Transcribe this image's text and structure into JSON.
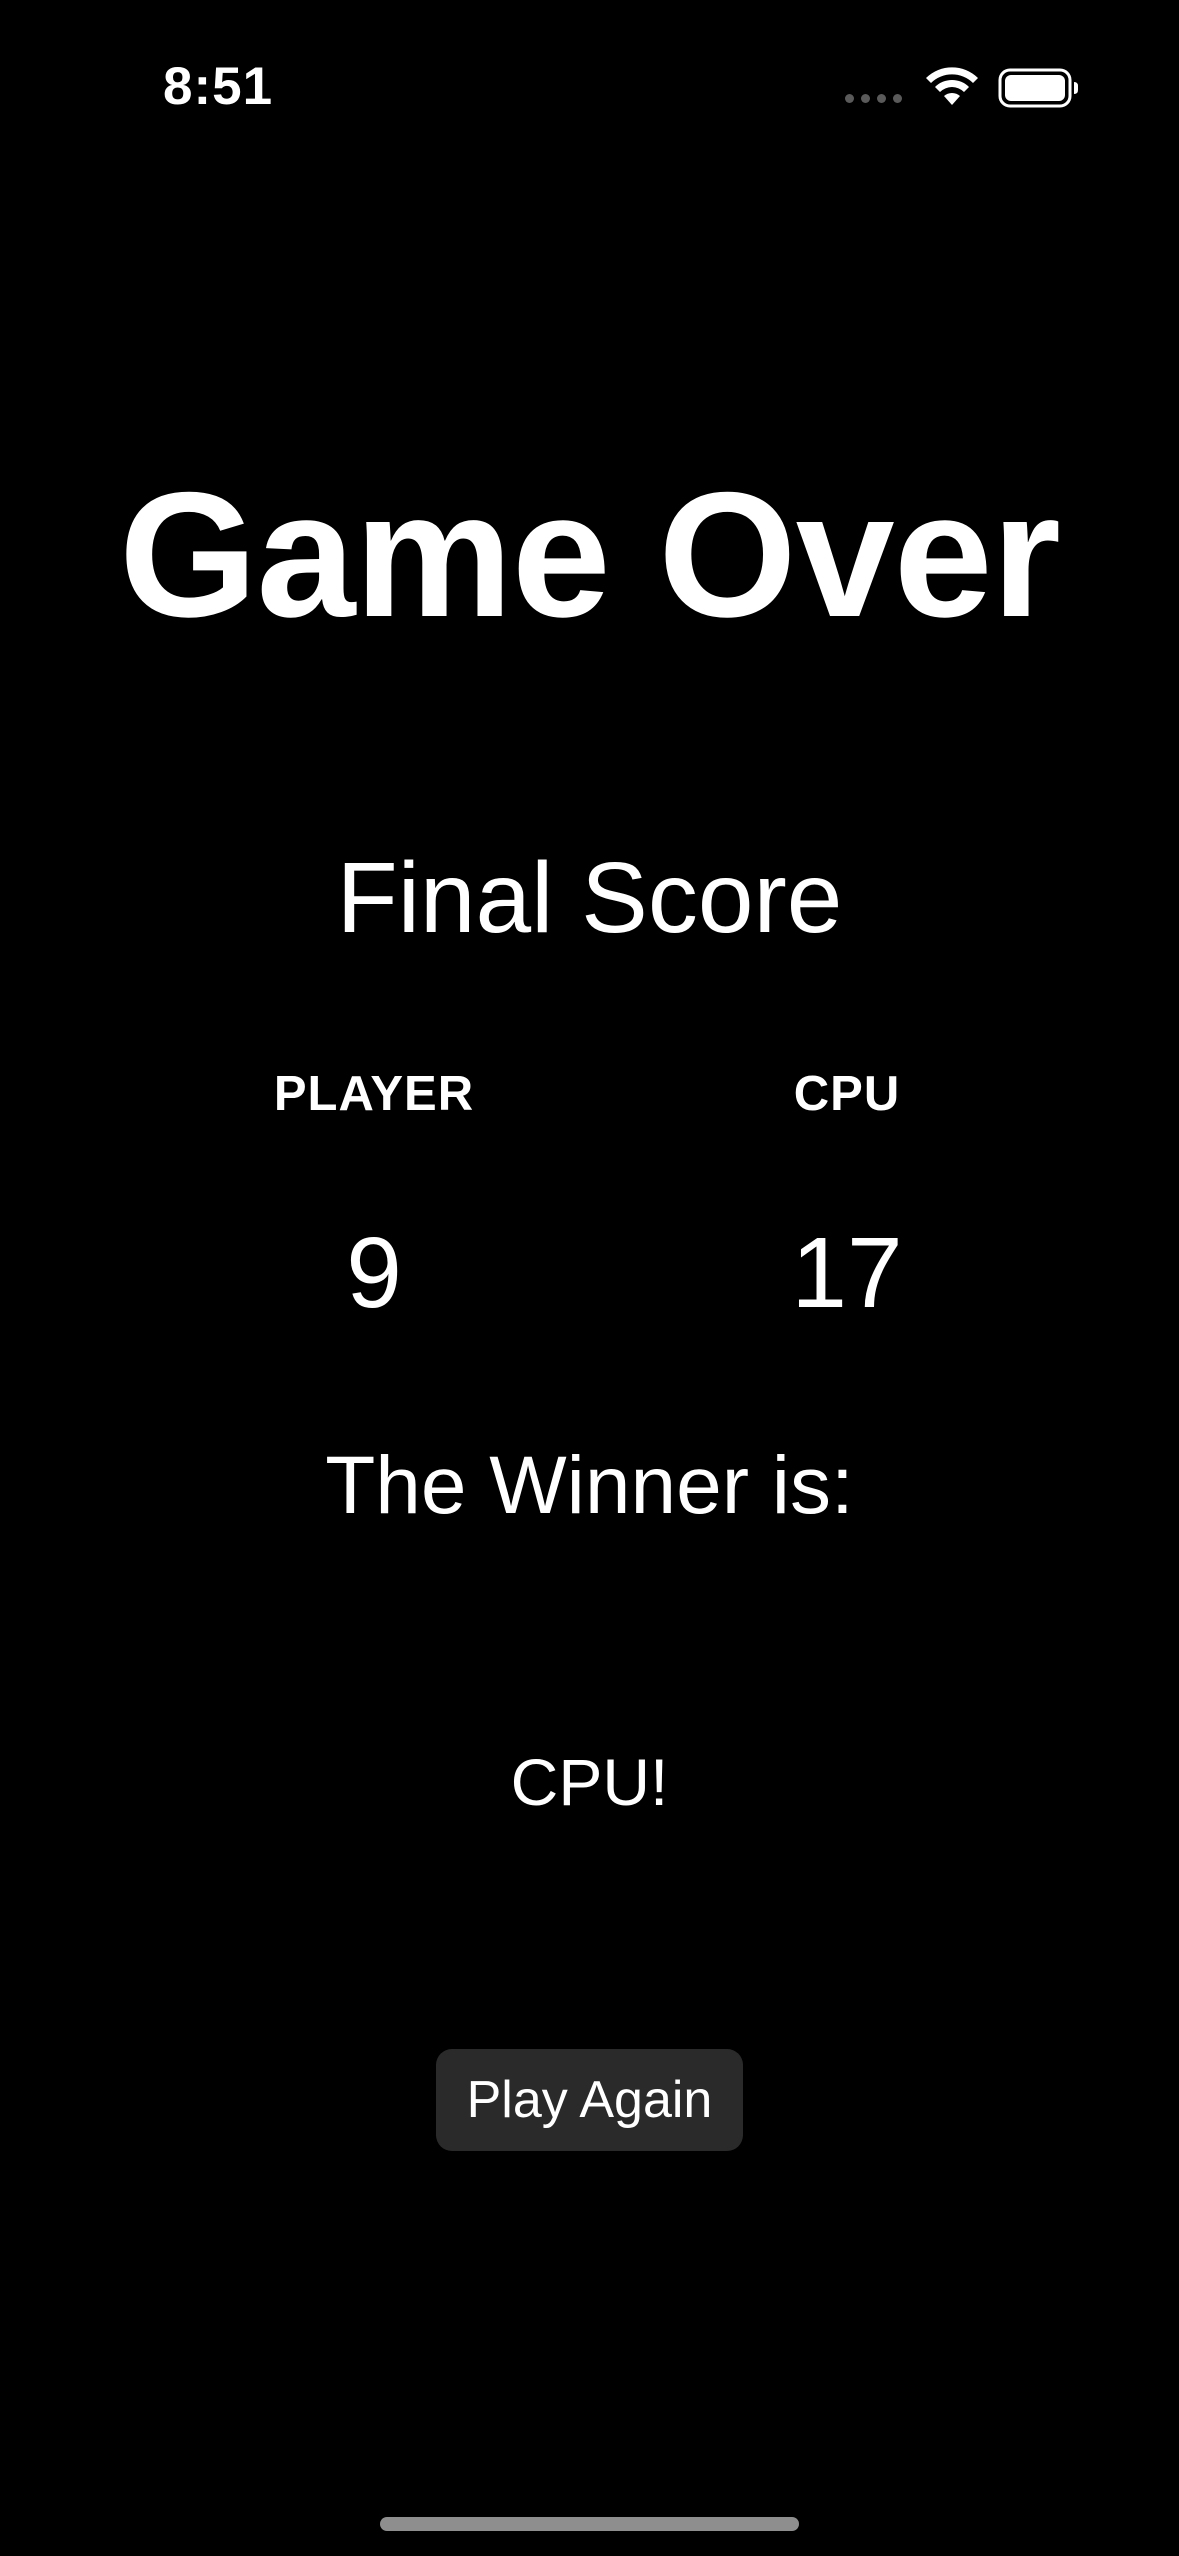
{
  "status_bar": {
    "time": "8:51",
    "icons": [
      "signal-dots-icon",
      "wifi-icon",
      "battery-icon"
    ]
  },
  "main": {
    "title": "Game Over",
    "final_score_heading": "Final Score",
    "player": {
      "label": "PLAYER",
      "score": "9"
    },
    "cpu": {
      "label": "CPU",
      "score": "17"
    },
    "winner_label": "The Winner is:",
    "winner_value": "CPU!",
    "play_again_label": "Play Again"
  },
  "colors": {
    "background": "#000000",
    "text": "#ffffff",
    "button_background": "#2a2a2a",
    "home_indicator": "#8e8e8e"
  }
}
